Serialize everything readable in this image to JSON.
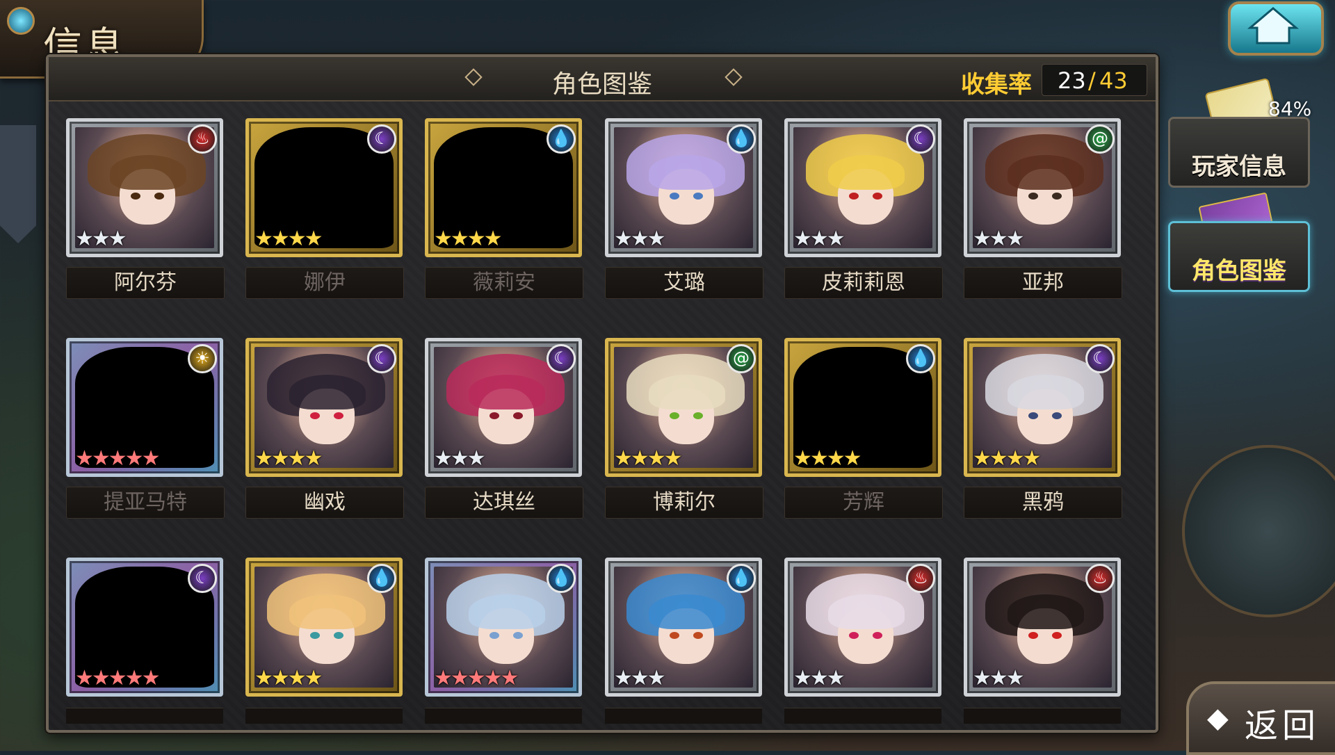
{
  "header": {
    "screen_title": "信息",
    "panel_title": "角色图鉴",
    "collection_label": "收集率",
    "collection_current": "23",
    "collection_separator": "/",
    "collection_total": "43"
  },
  "sidebar": {
    "player_info_label": "玩家信息",
    "player_info_progress": "84%",
    "codex_label": "角色图鉴"
  },
  "back_label": "返回",
  "elements": {
    "fire": {
      "icon": "fire-icon",
      "color": "#d92b2b",
      "glyph": "♨"
    },
    "moon": {
      "icon": "moon-icon",
      "color": "#7b3fc4",
      "glyph": "☾"
    },
    "water": {
      "icon": "water-drop-icon",
      "color": "#1f7fd6",
      "glyph": "💧"
    },
    "wind": {
      "icon": "wind-icon",
      "color": "#2aa84a",
      "glyph": "@"
    },
    "light": {
      "icon": "sun-icon",
      "color": "#e0a818",
      "glyph": "☀"
    }
  },
  "characters": [
    {
      "name": "阿尔芬",
      "element": "fire",
      "stars": 3,
      "frame": "silver",
      "unlocked": true,
      "hair": "#6b4424",
      "eye": "#4a2a10"
    },
    {
      "name": "娜伊",
      "element": "moon",
      "stars": 4,
      "frame": "gold",
      "unlocked": false
    },
    {
      "name": "薇莉安",
      "element": "water",
      "stars": 4,
      "frame": "gold",
      "unlocked": false
    },
    {
      "name": "艾璐",
      "element": "water",
      "stars": 3,
      "frame": "silver",
      "unlocked": true,
      "hair": "#b8a6e8",
      "eye": "#4a7ac0"
    },
    {
      "name": "皮莉莉恩",
      "element": "moon",
      "stars": 3,
      "frame": "silver",
      "unlocked": true,
      "hair": "#f0cc4a",
      "eye": "#c02020"
    },
    {
      "name": "亚邦",
      "element": "wind",
      "stars": 3,
      "frame": "silver",
      "unlocked": true,
      "hair": "#5a2e1e",
      "eye": "#3a2a20"
    },
    {
      "name": "提亚马特",
      "element": "light",
      "stars": 5,
      "frame": "rainbow",
      "unlocked": false
    },
    {
      "name": "幽戏",
      "element": "moon",
      "stars": 4,
      "frame": "gold",
      "unlocked": true,
      "hair": "#2a2230",
      "eye": "#d02040"
    },
    {
      "name": "达琪丝",
      "element": "moon",
      "stars": 3,
      "frame": "silver",
      "unlocked": true,
      "hair": "#b82a5a",
      "eye": "#8a1a2a"
    },
    {
      "name": "博莉尔",
      "element": "wind",
      "stars": 4,
      "frame": "gold",
      "unlocked": true,
      "hair": "#e8dcc0",
      "eye": "#6ab02a"
    },
    {
      "name": "芳辉",
      "element": "water",
      "stars": 4,
      "frame": "gold",
      "unlocked": false
    },
    {
      "name": "黑鸦",
      "element": "moon",
      "stars": 4,
      "frame": "gold",
      "unlocked": true,
      "hair": "#d8d8e0",
      "eye": "#3a4a7a"
    },
    {
      "name": "",
      "element": "moon",
      "stars": 5,
      "frame": "rainbow",
      "unlocked": false
    },
    {
      "name": "",
      "element": "water",
      "stars": 4,
      "frame": "gold",
      "unlocked": true,
      "hair": "#f0c27a",
      "eye": "#3a9aa0"
    },
    {
      "name": "",
      "element": "water",
      "stars": 5,
      "frame": "rainbow",
      "unlocked": true,
      "hair": "#b8d0ea",
      "eye": "#7aa0d0"
    },
    {
      "name": "",
      "element": "water",
      "stars": 3,
      "frame": "silver",
      "unlocked": true,
      "hair": "#3a8ad0",
      "eye": "#c04a20"
    },
    {
      "name": "",
      "element": "fire",
      "stars": 3,
      "frame": "silver",
      "unlocked": true,
      "hair": "#e8dce8",
      "eye": "#d0205a"
    },
    {
      "name": "",
      "element": "fire",
      "stars": 3,
      "frame": "silver",
      "unlocked": true,
      "hair": "#1e1616",
      "eye": "#d02020"
    }
  ]
}
